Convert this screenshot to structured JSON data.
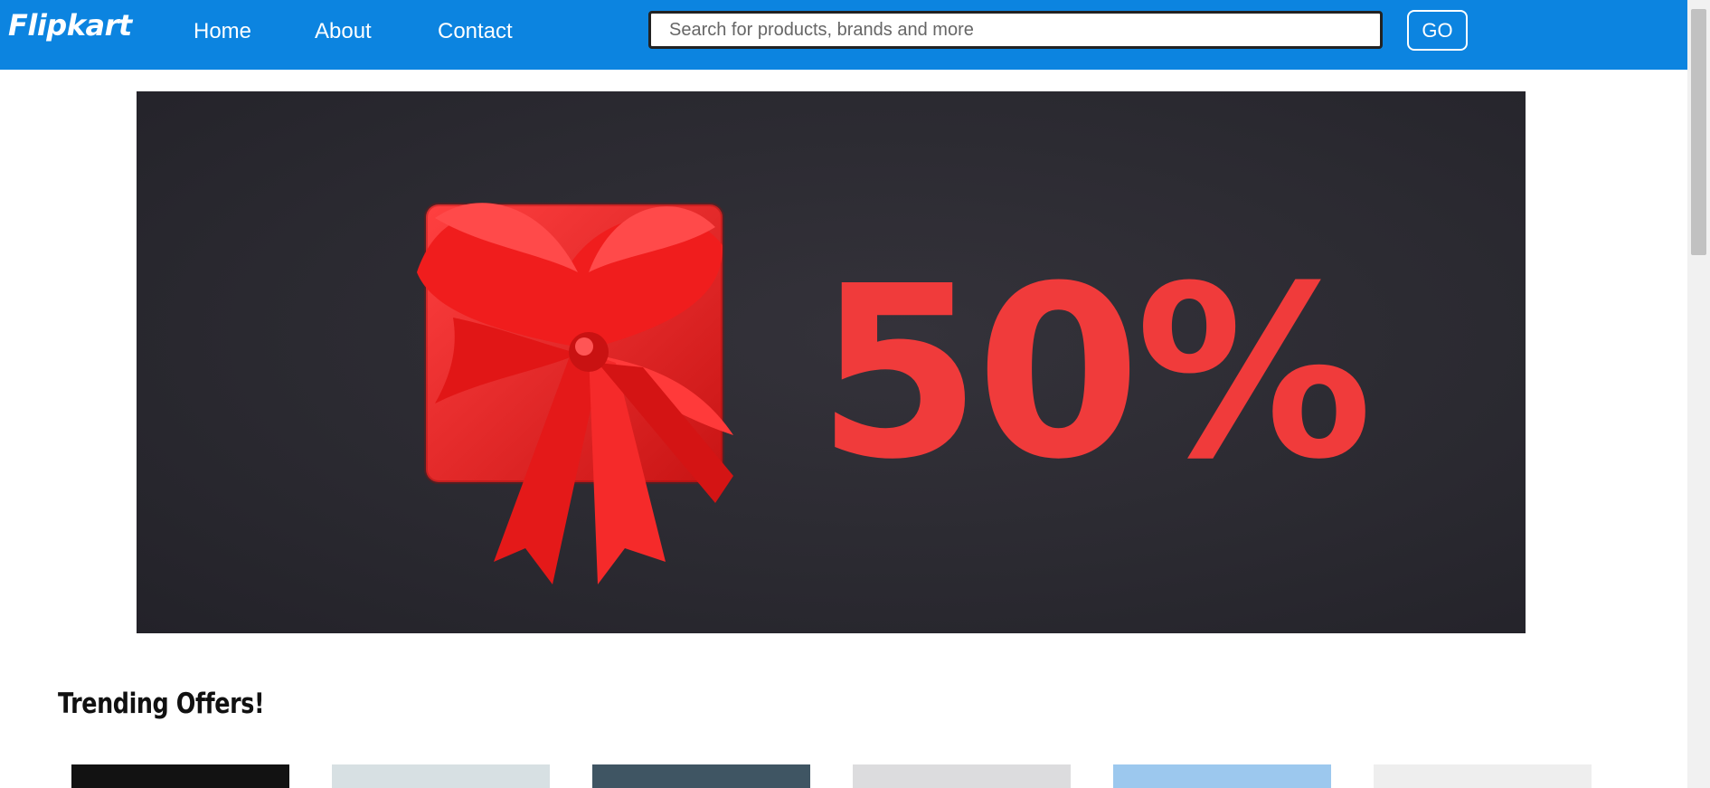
{
  "navbar": {
    "brand": "Flipkart",
    "links": [
      {
        "label": "Home"
      },
      {
        "label": "About"
      },
      {
        "label": "Contact"
      }
    ],
    "search": {
      "placeholder": "Search for products, brands and more",
      "value": ""
    },
    "go_label": "GO"
  },
  "banner": {
    "discount_text": "50%",
    "discount_color": "#f03b3b",
    "gift_color": "#e51f1f"
  },
  "trending": {
    "title": "Trending Offers!",
    "thumbnails": [
      {
        "color": "#121212"
      },
      {
        "color": "#d7e0e3"
      },
      {
        "color": "#3f5563"
      },
      {
        "color": "#dcdcde"
      },
      {
        "color": "#9cc8ee"
      },
      {
        "color": "#eeeeee"
      }
    ]
  }
}
